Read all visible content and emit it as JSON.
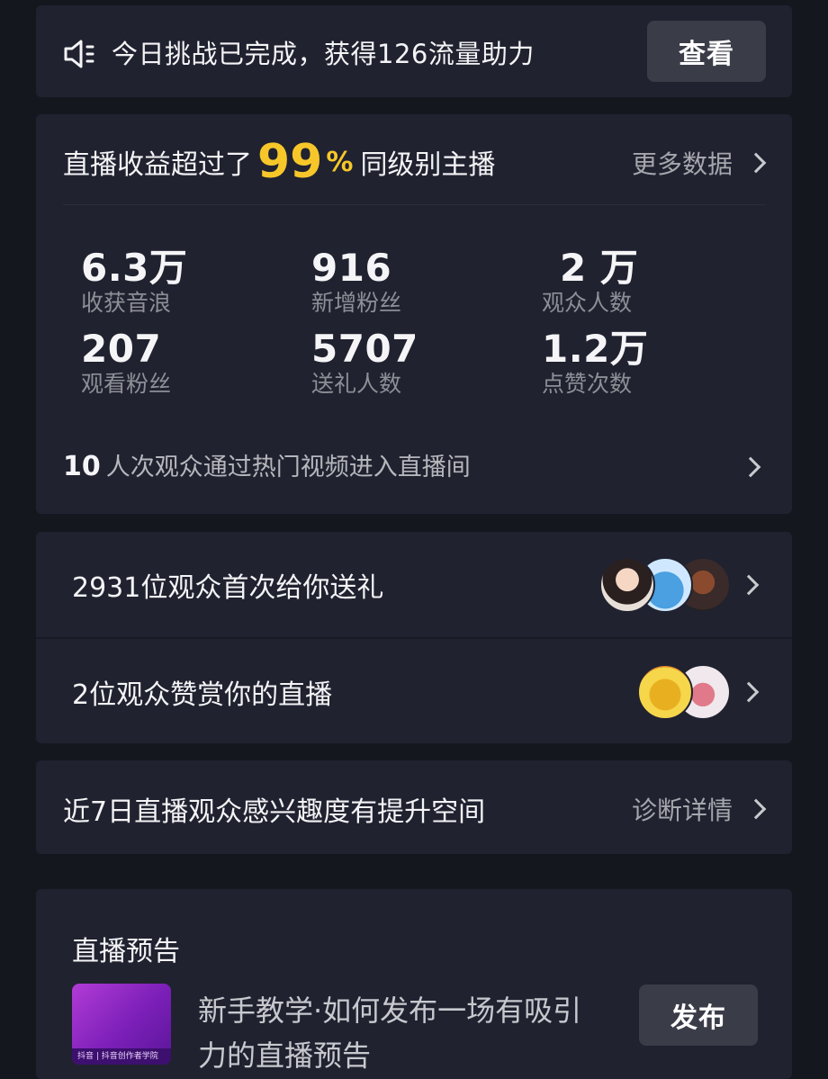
{
  "challenge": {
    "icon": "speaker-icon",
    "message": "今日挑战已完成，获得126流量助力",
    "button": "查看"
  },
  "earnings": {
    "prefix": "直播收益超过了",
    "percent_value": "99",
    "percent_sign": "%",
    "suffix": "同级别主播",
    "more_label": "更多数据",
    "metrics": [
      {
        "value": "6.3万",
        "label": "收获音浪"
      },
      {
        "value": "916",
        "label": "新增粉丝"
      },
      {
        "value": "2 万",
        "label": "观众人数"
      },
      {
        "value": "207",
        "label": "观看粉丝"
      },
      {
        "value": "5707",
        "label": "送礼人数"
      },
      {
        "value": "1.2万",
        "label": "点赞次数"
      }
    ],
    "hot_count": "10",
    "hot_text": "人次观众通过热门视频进入直播间"
  },
  "gifts": {
    "first_gift_text": "2931位观众首次给你送礼",
    "appreciate_text": "2位观众赞赏你的直播"
  },
  "diagnose": {
    "text": "近7日直播观众感兴趣度有提升空间",
    "more_label": "诊断详情"
  },
  "preview": {
    "title": "直播预告",
    "thumb_caption": "抖音 | 抖音创作者学院",
    "description": "新手教学·如何发布一场有吸引力的直播预告",
    "button": "发布"
  },
  "colors": {
    "background": "#15171f",
    "card": "#202230",
    "accent": "#f7c72a",
    "button": "#3a3c48"
  }
}
